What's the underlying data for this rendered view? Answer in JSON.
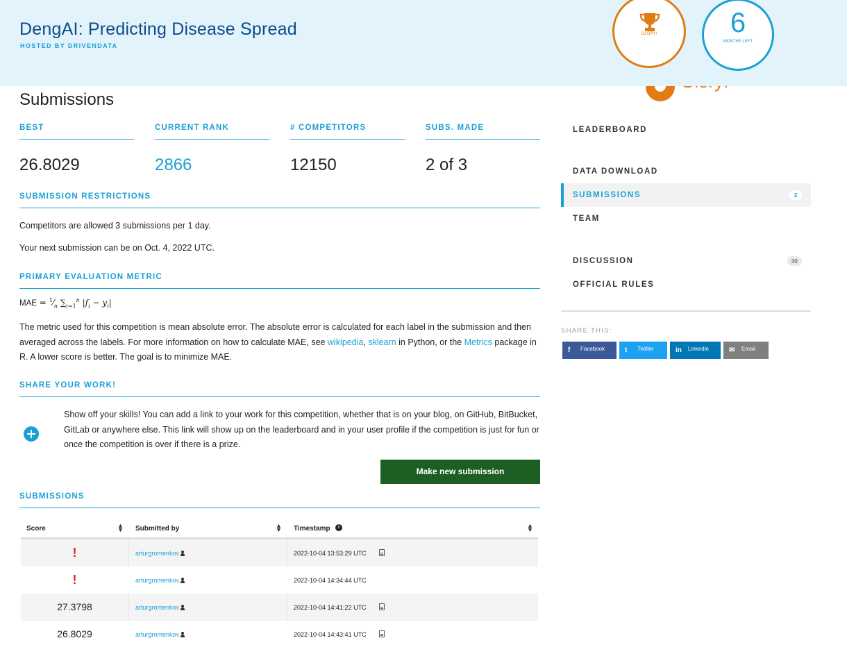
{
  "header": {
    "title": "DengAI: Predicting Disease Spread",
    "hosted": "HOSTED BY DRIVENDATA",
    "glory_label": "GLORY!",
    "months_number": "6",
    "months_label": "MONTHS LEFT",
    "glory_peek_text": "Glory!"
  },
  "page_title": "Submissions",
  "stats": {
    "best_label": "BEST",
    "best_value": "26.8029",
    "rank_label": "CURRENT RANK",
    "rank_value": "2866",
    "competitors_label": "# COMPETITORS",
    "competitors_value": "12150",
    "subs_label": "SUBS. MADE",
    "subs_value": "2 of 3"
  },
  "restrictions": {
    "heading": "SUBMISSION RESTRICTIONS",
    "line1": "Competitors are allowed 3 submissions per 1 day.",
    "line2": "Your next submission can be on Oct. 4, 2022 UTC."
  },
  "metric": {
    "heading": "PRIMARY EVALUATION METRIC",
    "formula_label": "MAE",
    "text_before": "The metric used for this competition is mean absolute error. The absolute error is calculated for each label in the submission and then averaged across the labels. For more information on how to calculate MAE, see ",
    "link_wikipedia": "wikipedia",
    "text_comma": ", ",
    "link_sklearn": "sklearn",
    "text_mid": " in Python, or the ",
    "link_metrics": "Metrics",
    "text_after": " package in R. A lower score is better. The goal is to minimize MAE."
  },
  "share_work": {
    "heading": "SHARE YOUR WORK!",
    "text": "Show off your skills! You can add a link to your work for this competition, whether that is on your blog, on GitHub, BitBucket, GitLab or anywhere else. This link will show up on the leaderboard and in your user profile if the competition is just for fun or once the competition is over if there is a prize."
  },
  "make_submission_label": "Make new submission",
  "submissions": {
    "heading": "SUBMISSIONS",
    "columns": {
      "score": "Score",
      "submitted_by": "Submitted by",
      "timestamp": "Timestamp"
    },
    "rows": [
      {
        "score": "!",
        "user": "arturgromenkov",
        "timestamp": "2022-10-04 13:53:29 UTC",
        "has_file": true
      },
      {
        "score": "!",
        "user": "arturgromenkov",
        "timestamp": "2022-10-04 14:34:44 UTC",
        "has_file": false
      },
      {
        "score": "27.3798",
        "user": "arturgromenkov",
        "timestamp": "2022-10-04 14:41:22 UTC",
        "has_file": true
      },
      {
        "score": "26.8029",
        "user": "arturgromenkov",
        "timestamp": "2022-10-04 14:43:41 UTC",
        "has_file": true
      }
    ]
  },
  "sidebar": {
    "items": [
      {
        "label": "LEADERBOARD",
        "badge": ""
      },
      {
        "label": "DATA DOWNLOAD",
        "badge": ""
      },
      {
        "label": "SUBMISSIONS",
        "badge": "2"
      },
      {
        "label": "TEAM",
        "badge": ""
      },
      {
        "label": "DISCUSSION",
        "badge": "30"
      },
      {
        "label": "OFFICIAL RULES",
        "badge": ""
      }
    ],
    "share_label": "SHARE THIS:",
    "share_buttons": [
      {
        "label": "Facebook",
        "icon": "f",
        "color": "#3b5998"
      },
      {
        "label": "Twitter",
        "icon": "t",
        "color": "#1da1f2"
      },
      {
        "label": "Linkedin",
        "icon": "in",
        "color": "#0077b5"
      },
      {
        "label": "Email",
        "icon": "✉",
        "color": "#7f7f7f"
      }
    ]
  },
  "colors": {
    "accent": "#1ba0d6",
    "glory": "#e07c12",
    "button": "#1d5e22",
    "error": "#e02020"
  }
}
